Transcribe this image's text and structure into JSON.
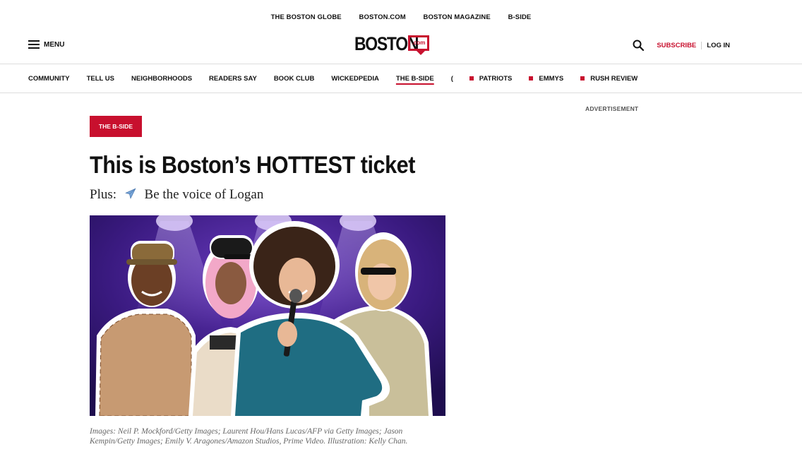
{
  "top_links": [
    "THE BOSTON GLOBE",
    "BOSTON.COM",
    "BOSTON MAGAZINE",
    "B-SIDE"
  ],
  "header": {
    "menu_label": "MENU",
    "logo_word": "BOSTON",
    "logo_suffix": ".com",
    "subscribe_label": "SUBSCRIBE",
    "login_label": "LOG IN"
  },
  "section_nav": {
    "items": [
      {
        "label": "COMMUNITY"
      },
      {
        "label": "TELL US"
      },
      {
        "label": "NEIGHBORHOODS"
      },
      {
        "label": "READERS SAY"
      },
      {
        "label": "BOOK CLUB"
      },
      {
        "label": "WICKEDPEDIA"
      },
      {
        "label": "THE B-SIDE"
      },
      {
        "label": "("
      },
      {
        "label": "PATRIOTS"
      },
      {
        "label": "EMMYS"
      },
      {
        "label": "RUSH REVIEW"
      }
    ]
  },
  "article": {
    "tag": "THE B-SIDE",
    "headline": "This is Boston’s HOTTEST ticket",
    "subhead_prefix": "Plus:",
    "subhead_icon": "airplane-icon",
    "subhead_text": "Be the voice of Logan",
    "image_caption": "Images: Neil P. Mockford/Getty Images; Laurent Hou/Hans Lucas/AFP via Getty Images; Jason Kempin/Getty Images; Emily V. Aragones/Amazon Studios, Prime Video. Illustration: Kelly Chan."
  },
  "sidebar": {
    "ad_label": "ADVERTISEMENT"
  },
  "colors": {
    "brand_red": "#c8102e",
    "hero_background": "#2d1560"
  }
}
